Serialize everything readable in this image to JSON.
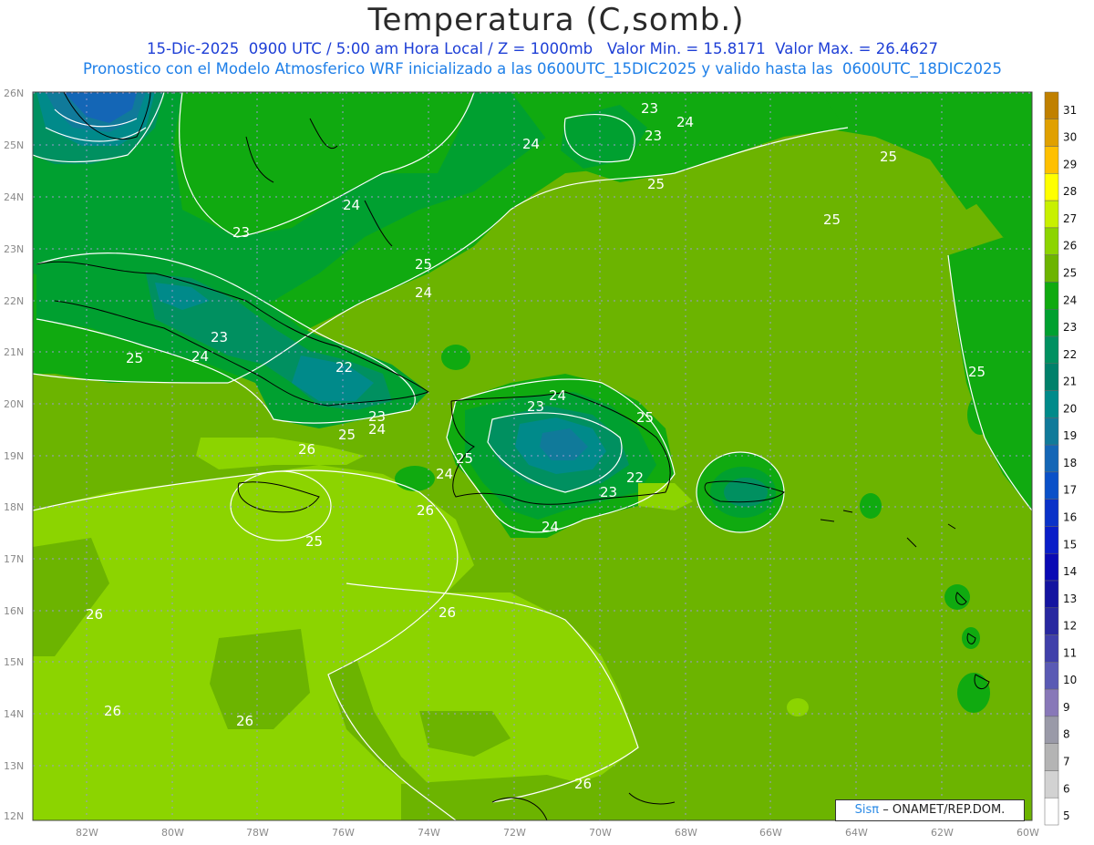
{
  "header": {
    "title": "Temperatura (C,somb.)",
    "subtitle1": "15-Dic-2025  0900 UTC / 5:00 am Hora Local / Z = 1000mb   Valor Min. = 15.8171  Valor Max. = 26.4627",
    "subtitle2": "Pronostico con el Modelo Atmosferico WRF inicializado a las 0600UTC_15DIC2025 y valido hasta las  0600UTC_18DIC2025"
  },
  "map": {
    "lat_labels": [
      "26N",
      "25N",
      "24N",
      "23N",
      "22N",
      "21N",
      "20N",
      "19N",
      "18N",
      "17N",
      "16N",
      "15N",
      "14N",
      "13N",
      "12N"
    ],
    "lon_labels": [
      "82W",
      "80W",
      "78W",
      "76W",
      "74W",
      "72W",
      "70W",
      "68W",
      "66W",
      "64W",
      "62W",
      "60W"
    ],
    "contour_labels": [
      "23",
      "24",
      "23",
      "24",
      "25",
      "24",
      "23",
      "25",
      "25",
      "24",
      "23",
      "22",
      "23",
      "24",
      "25",
      "26",
      "25",
      "24",
      "24",
      "25",
      "23",
      "24",
      "25",
      "22",
      "23",
      "24",
      "25",
      "26",
      "26",
      "26",
      "26",
      "26",
      "26",
      "25",
      "25"
    ]
  },
  "colorbar": {
    "levels": [
      "31",
      "30",
      "29",
      "28",
      "27",
      "26",
      "25",
      "24",
      "23",
      "22",
      "21",
      "20",
      "19",
      "18",
      "17",
      "16",
      "15",
      "14",
      "13",
      "12",
      "11",
      "10",
      "9",
      "8",
      "7",
      "6",
      "5"
    ],
    "colors": [
      "#c08000",
      "#e0a000",
      "#ffc000",
      "#ffff00",
      "#c8f000",
      "#8cd400",
      "#6cb400",
      "#10aa10",
      "#00a030",
      "#009060",
      "#00806a",
      "#008a8a",
      "#107a9a",
      "#1466b6",
      "#0a50c8",
      "#0a32c8",
      "#0a1ec8",
      "#0a0ab4",
      "#1414a0",
      "#2828a0",
      "#4040aa",
      "#5a5ab4",
      "#8878b8",
      "#9a9aa8",
      "#b4b4b4",
      "#d2d2d2",
      "#ffffff"
    ]
  },
  "credit": {
    "sis": "Sisπ",
    "rest": "– ONAMET/REP.DOM."
  }
}
